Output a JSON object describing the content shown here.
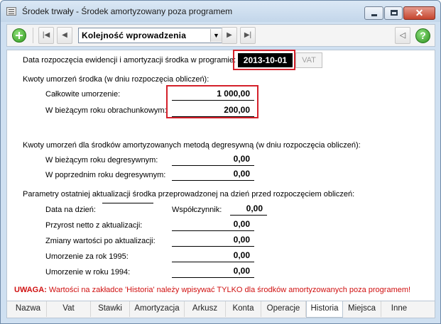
{
  "window": {
    "title": "Środek trwały - Środek amortyzowany poza programem"
  },
  "toolbar": {
    "sort_selected": "Kolejność wprowadzenia",
    "help_glyph": "?",
    "side_glyph": "◁"
  },
  "start": {
    "label": "Data rozpoczęcia ewidencji i amortyzacji środka w programie:",
    "date": "2013-10-01",
    "vat_button": "VAT"
  },
  "section1": {
    "title": "Kwoty umorzeń środka (w dniu rozpoczęcia obliczeń):",
    "total_label": "Całkowite umorzenie:",
    "total_value": "1 000,00",
    "current_label": "W bieżącym roku obrachunkowym:",
    "current_value": "200,00"
  },
  "section2": {
    "title": "Kwoty umorzeń dla środków amortyzowanych metodą degresywną (w dniu rozpoczęcia obliczeń):",
    "current_label": "W bieżącym roku degresywnym:",
    "current_value": "0,00",
    "previous_label": "W poprzednim roku degresywnym:",
    "previous_value": "0,00"
  },
  "section3": {
    "title": "Parametry ostatniej aktualizacji środka przeprowadzonej na dzień przed rozpoczęciem obliczeń:",
    "date_label": "Data na dzień:",
    "date_value": "",
    "coef_label": "Współczynnik:",
    "coef_value": "0,00",
    "net_label": "Przyrost netto z aktualizacji:",
    "net_value": "0,00",
    "changes_label": "Zmiany wartości po aktualizacji:",
    "changes_value": "0,00",
    "dep1995_label": "Umorzenie za rok 1995:",
    "dep1995_value": "0,00",
    "dep1994_label": "Umorzenie w roku 1994:",
    "dep1994_value": "0,00"
  },
  "warning": {
    "prefix": "UWAGA:",
    "text": "Wartości na zakładce 'Historia' należy wpisywać TYLKO dla środków amortyzowanych poza programem!"
  },
  "tabs": [
    "Nazwa",
    "Vat",
    "Stawki",
    "Amortyzacja",
    "Arkusz",
    "Konta",
    "Operacje",
    "Historia",
    "Miejsca",
    "Inne"
  ],
  "colors": {
    "highlight_box": "#d4202a",
    "warning_text": "#d01010"
  }
}
